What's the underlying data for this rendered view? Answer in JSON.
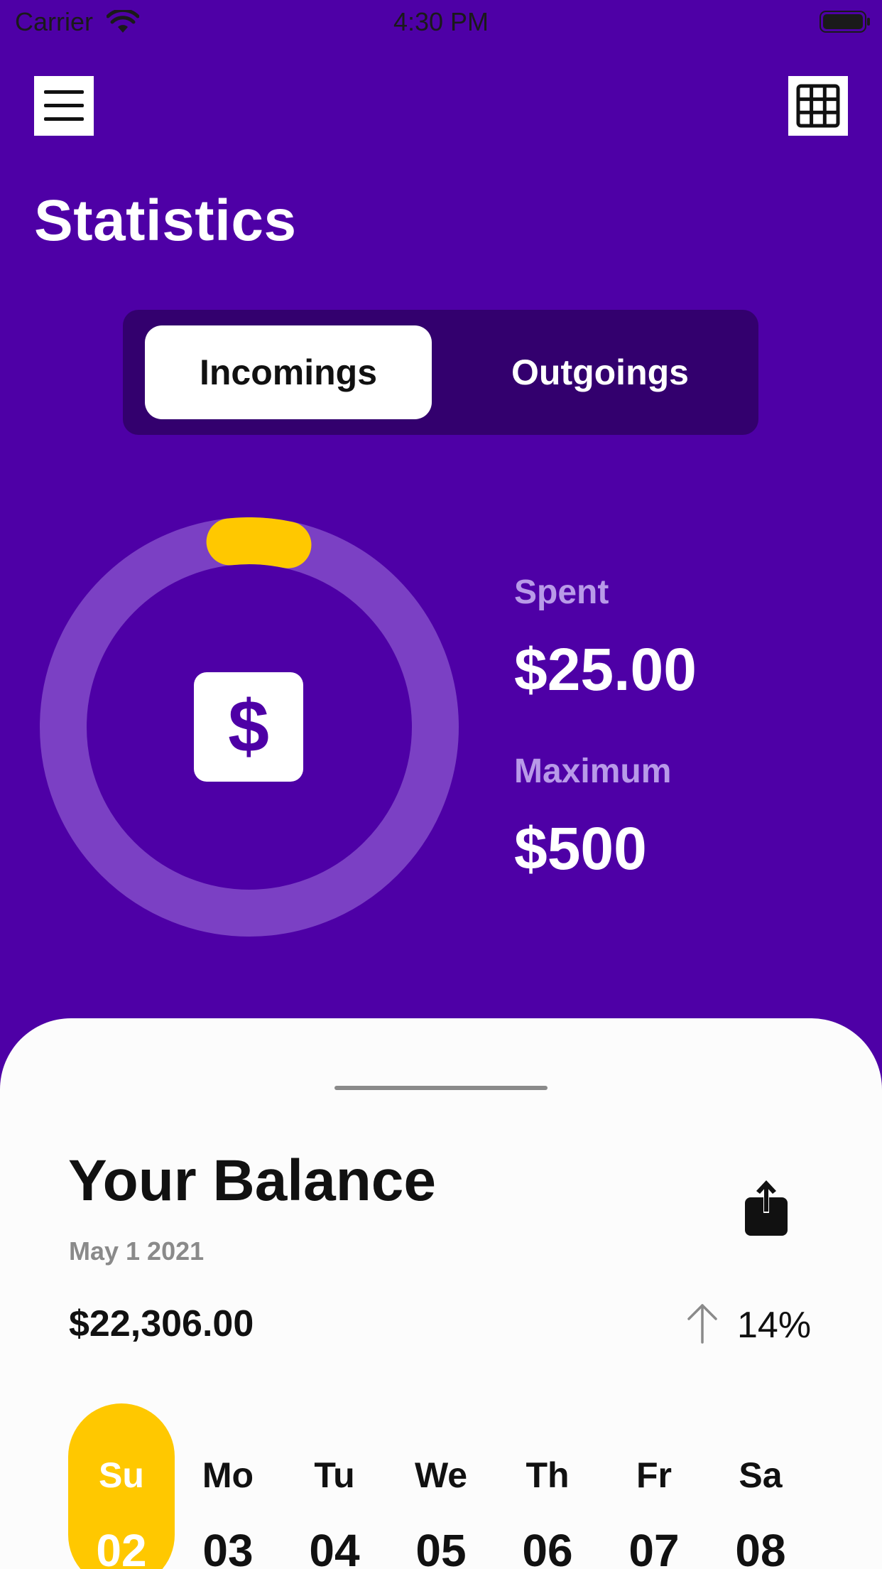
{
  "status_bar": {
    "carrier": "Carrier",
    "time": "4:30 PM"
  },
  "header": {
    "menu_icon": "hamburger-icon",
    "grid_icon": "grid-icon",
    "title": "Statistics"
  },
  "segments": {
    "incomings_label": "Incomings",
    "outgoings_label": "Outgoings",
    "selected": "Incomings"
  },
  "stats": {
    "spent_label": "Spent",
    "spent_value": "$25.00",
    "maximum_label": "Maximum",
    "maximum_value": "$500",
    "progress_fraction": 0.05,
    "center_symbol": "$"
  },
  "balance": {
    "title": "Your Balance",
    "date": "May 1 2021",
    "amount": "$22,306.00",
    "change": "14%",
    "change_icon": "arrow-up-icon",
    "share_icon": "share-icon"
  },
  "days": [
    {
      "name": "Su",
      "num": "02",
      "selected": true
    },
    {
      "name": "Mo",
      "num": "03",
      "selected": false
    },
    {
      "name": "Tu",
      "num": "04",
      "selected": false
    },
    {
      "name": "We",
      "num": "05",
      "selected": false
    },
    {
      "name": "Th",
      "num": "06",
      "selected": false
    },
    {
      "name": "Fr",
      "num": "07",
      "selected": false
    },
    {
      "name": "Sa",
      "num": "08",
      "selected": false
    }
  ],
  "colors": {
    "background": "#4e00a6",
    "segment_track": "#33006e",
    "ring_track": "#7b40c4",
    "ring_progress": "#ffc800",
    "accent_label": "#b89ae8",
    "sheet": "#fcfcfc"
  }
}
